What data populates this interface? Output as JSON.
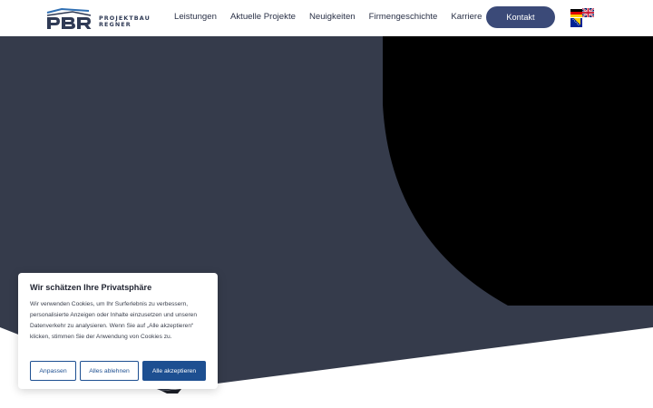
{
  "header": {
    "logo": {
      "mark_text": "PBR",
      "line1": "PROJEKTBAU",
      "line2": "REGNER"
    },
    "nav": [
      {
        "label": "Leistungen"
      },
      {
        "label": "Aktuelle Projekte"
      },
      {
        "label": "Neuigkeiten"
      },
      {
        "label": "Firmengeschichte"
      },
      {
        "label": "Karriere"
      }
    ],
    "contact_label": "Kontakt",
    "languages": [
      {
        "icon": "flag-de-icon"
      },
      {
        "icon": "flag-gb-icon"
      },
      {
        "icon": "flag-ba-icon"
      }
    ]
  },
  "colors": {
    "hero_dark": "#353b4b",
    "hero_black": "#000000",
    "brand_blue": "#3b4a78",
    "cookie_blue": "#1d4f91"
  },
  "cookie_banner": {
    "title": "Wir schätzen Ihre Privatsphäre",
    "text": "Wir verwenden Cookies, um Ihr Surferlebnis zu verbessern, personalisierte Anzeigen oder Inhalte einzusetzen und unseren Datenverkehr zu analysieren. Wenn Sie auf „Alle akzeptieren“ klicken, stimmen Sie der Anwendung von Cookies zu.",
    "buttons": {
      "customize": "Anpassen",
      "reject_all": "Alles ablehnen",
      "accept_all": "Alle akzeptieren"
    }
  }
}
